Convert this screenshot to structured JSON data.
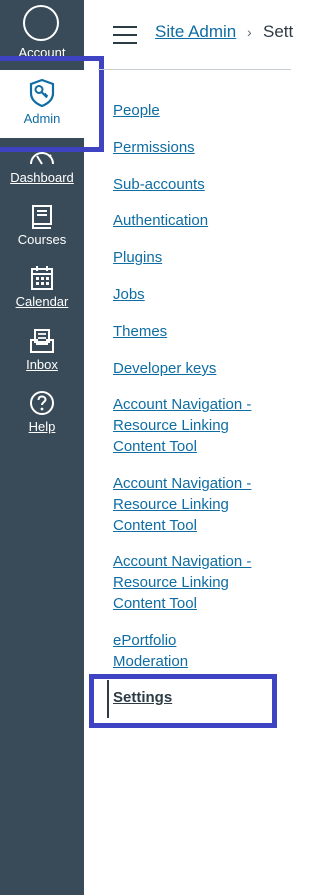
{
  "global_nav": {
    "account": "Account",
    "admin": "Admin",
    "dashboard": "Dashboard",
    "courses": "Courses",
    "calendar": "Calendar",
    "inbox": "Inbox",
    "help": "Help"
  },
  "breadcrumb": {
    "parent": "Site Admin",
    "separator": "›",
    "current": "Sett"
  },
  "section_nav": {
    "items": [
      "People",
      "Permissions",
      "Sub-accounts",
      "Authentication",
      "Plugins",
      "Jobs",
      "Themes",
      "Developer keys",
      "Account Navigation - Resource Linking Content Tool",
      "Account Navigation - Resource Linking Content Tool",
      "Account Navigation - Resource Linking Content Tool",
      "ePortfolio Moderation",
      "Settings"
    ],
    "active": "Settings"
  },
  "colors": {
    "nav_bg": "#394b58",
    "link": "#0f6da3",
    "highlight": "#3d43c2"
  },
  "icons": [
    "account-avatar-icon",
    "admin-shield-key-icon",
    "dashboard-icon",
    "courses-book-icon",
    "calendar-icon",
    "inbox-icon",
    "help-icon",
    "hamburger-icon"
  ]
}
